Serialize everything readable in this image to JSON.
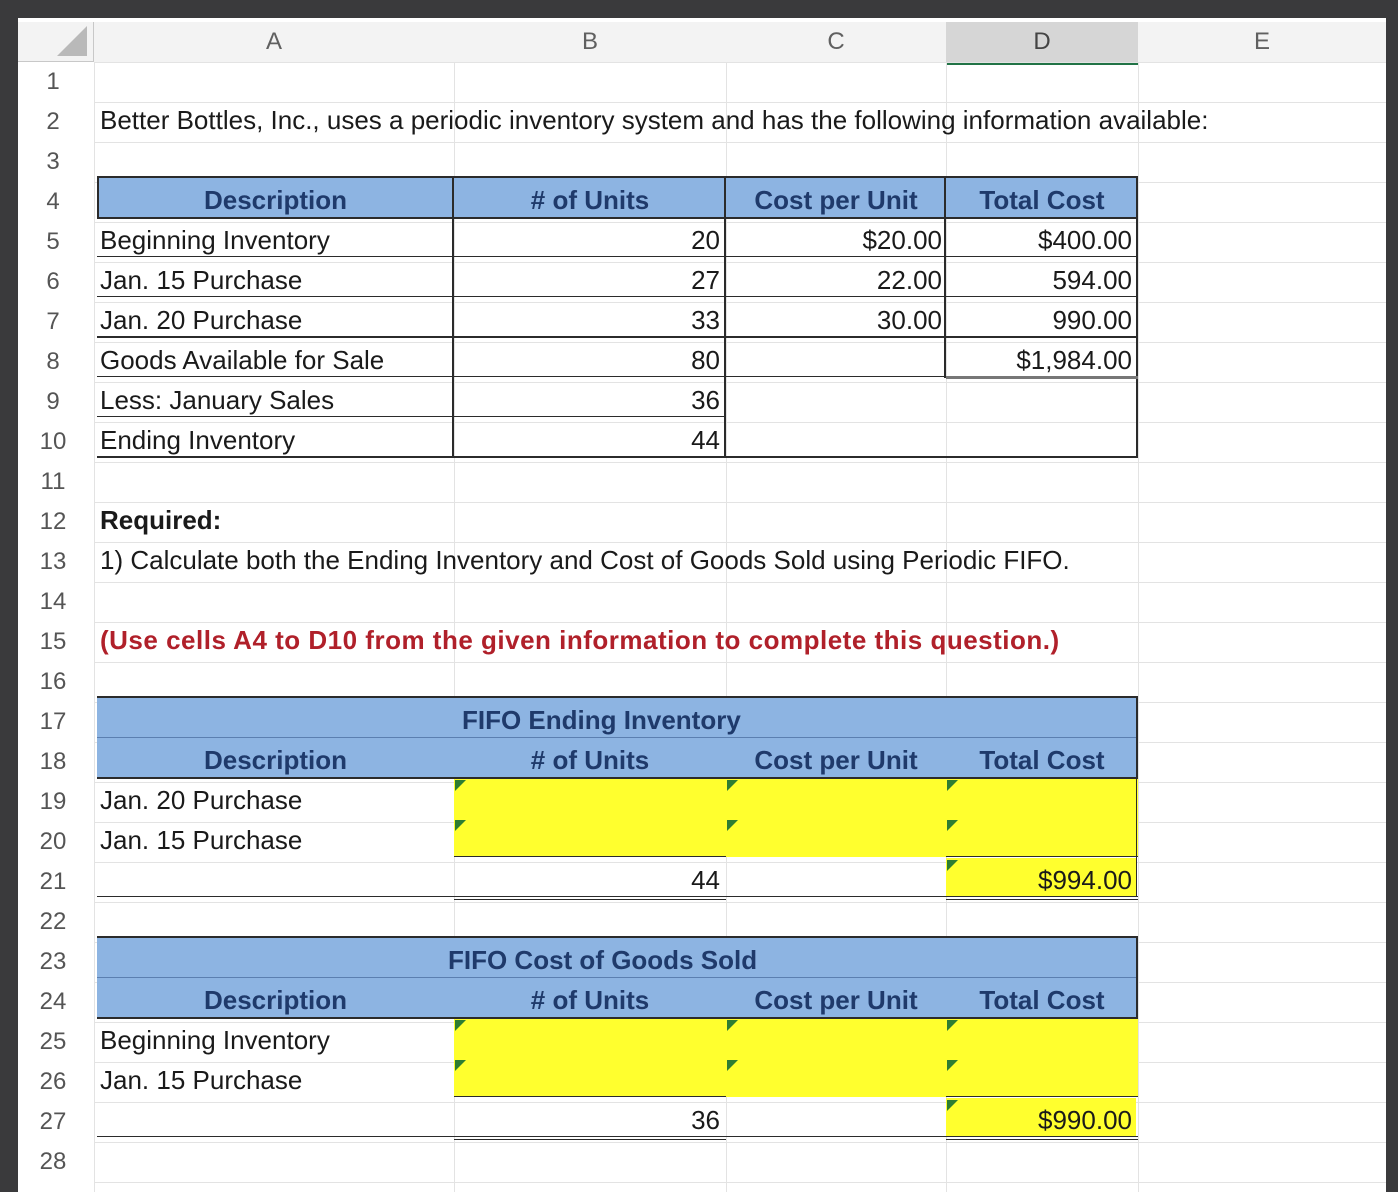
{
  "columns": [
    "A",
    "B",
    "C",
    "D",
    "E"
  ],
  "rows": [
    "1",
    "2",
    "3",
    "4",
    "5",
    "6",
    "7",
    "8",
    "9",
    "10",
    "11",
    "12",
    "13",
    "14",
    "15",
    "16",
    "17",
    "18",
    "19",
    "20",
    "21",
    "22",
    "23",
    "24",
    "25",
    "26",
    "27",
    "28"
  ],
  "intro": "Better Bottles, Inc., uses a periodic inventory system and has the following information available:",
  "info_table": {
    "headers": [
      "Description",
      "# of Units",
      "Cost per Unit",
      "Total Cost"
    ],
    "rows": [
      {
        "desc": "Beginning Inventory",
        "units": "20",
        "cost": "$20.00",
        "total": "$400.00"
      },
      {
        "desc": "Jan. 15 Purchase",
        "units": "27",
        "cost": "22.00",
        "total": "594.00"
      },
      {
        "desc": "Jan. 20 Purchase",
        "units": "33",
        "cost": "30.00",
        "total": "990.00"
      },
      {
        "desc": "Goods Available for Sale",
        "units": "80",
        "cost": "",
        "total": "$1,984.00"
      },
      {
        "desc": "Less: January Sales",
        "units": "36",
        "cost": "",
        "total": ""
      },
      {
        "desc": "Ending Inventory",
        "units": "44",
        "cost": "",
        "total": ""
      }
    ]
  },
  "required_label": "Required:",
  "question1": "1) Calculate both the Ending Inventory and Cost of Goods Sold using Periodic FIFO.",
  "instruction": "(Use cells A4 to D10 from the given information to complete this question.)",
  "fifo_ei": {
    "title": "FIFO Ending Inventory",
    "headers": [
      "Description",
      "# of Units",
      "Cost per Unit",
      "Total Cost"
    ],
    "rows": [
      "Jan. 20 Purchase",
      "Jan. 15 Purchase"
    ],
    "total_units": "44",
    "total_cost": "$994.00"
  },
  "fifo_cogs": {
    "title": "FIFO Cost of Goods Sold",
    "headers": [
      "Description",
      "# of Units",
      "Cost per Unit",
      "Total Cost"
    ],
    "rows": [
      "Beginning Inventory",
      "Jan. 15 Purchase"
    ],
    "total_units": "36",
    "total_cost": "$990.00"
  },
  "colors": {
    "header_fill": "#8db4e2",
    "input_fill": "#ffff2e",
    "instruction_text": "#b0202a",
    "selected_column": "#217346"
  }
}
